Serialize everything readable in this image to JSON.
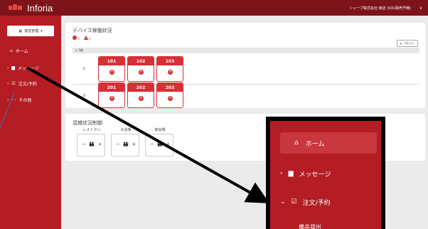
{
  "app": {
    "title": "Inforia",
    "user_name": "シャープ株式会社 様店 (SOL販売予備)",
    "user_caret": "∨"
  },
  "sidebar": {
    "store_select": "運営管理",
    "items": [
      {
        "label": "ホーム",
        "chevron": "",
        "icon": "home-icon"
      },
      {
        "label": "メッセージ",
        "chevron": "›",
        "icon": "message-icon"
      },
      {
        "label": "注文/予約",
        "chevron": "›",
        "icon": "order-icon"
      },
      {
        "label": "その他",
        "chevron": "›",
        "icon": "more-icon"
      }
    ]
  },
  "device_panel": {
    "title": "デバイス稼働状況",
    "legend": {
      "error_count": "0",
      "warn_count": "0"
    },
    "reset_label": "リセット",
    "floor_header": "∨ 1階",
    "floors": [
      {
        "label": "1F",
        "devices": [
          "101",
          "102",
          "103"
        ]
      },
      {
        "label": "2F",
        "devices": [
          "201",
          "202",
          "203"
        ]
      }
    ]
  },
  "congestion_panel": {
    "title": "混雑状況制御",
    "groups": [
      {
        "label": "レストラン"
      },
      {
        "label": "大浴場"
      },
      {
        "label": "宴会場"
      }
    ],
    "minus": "−",
    "plus": "+"
  },
  "zoom": {
    "home": "ホーム",
    "message": "メッセージ",
    "order": "注文/予約",
    "sub_item": "備品貸出"
  },
  "colors": {
    "brand_dark": "#7c1419",
    "brand": "#b41d24",
    "accent": "#d62f35"
  }
}
